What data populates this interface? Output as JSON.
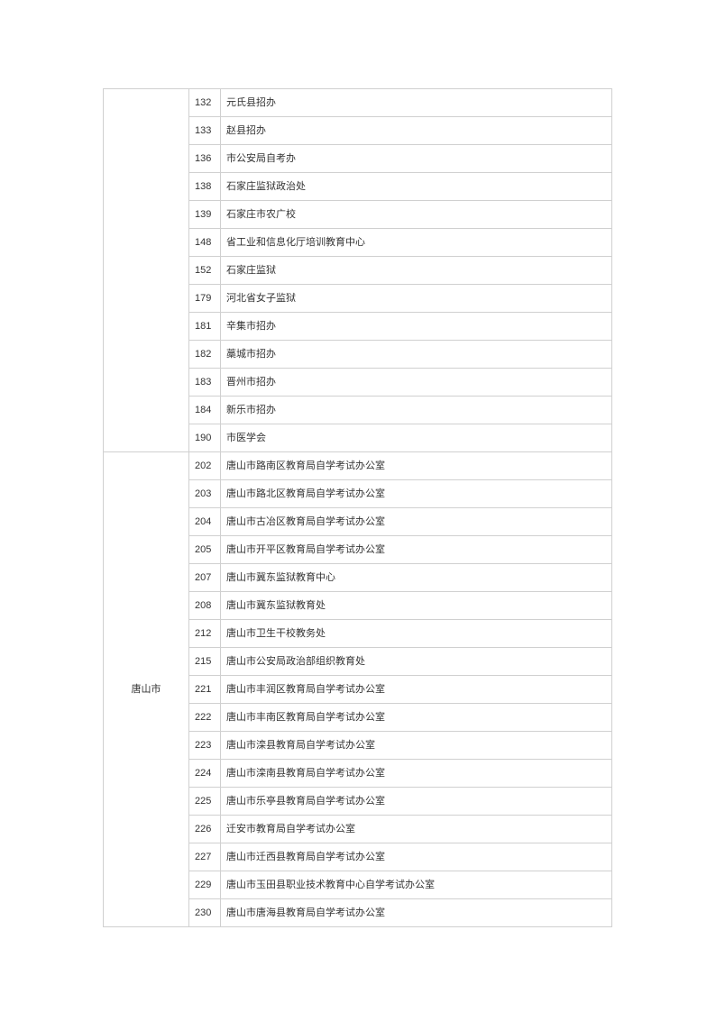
{
  "groups": [
    {
      "region": "",
      "rows": [
        {
          "code": "132",
          "name": "元氏县招办"
        },
        {
          "code": "133",
          "name": "赵县招办"
        },
        {
          "code": "136",
          "name": "市公安局自考办"
        },
        {
          "code": "138",
          "name": "石家庄监狱政治处"
        },
        {
          "code": "139",
          "name": "石家庄市农广校"
        },
        {
          "code": "148",
          "name": "省工业和信息化厅培训教育中心"
        },
        {
          "code": "152",
          "name": "石家庄监狱"
        },
        {
          "code": "179",
          "name": "河北省女子监狱"
        },
        {
          "code": "181",
          "name": "辛集市招办"
        },
        {
          "code": "182",
          "name": "藁城市招办"
        },
        {
          "code": "183",
          "name": "晋州市招办"
        },
        {
          "code": "184",
          "name": "新乐市招办"
        },
        {
          "code": "190",
          "name": "市医学会"
        }
      ]
    },
    {
      "region": "唐山市",
      "rows": [
        {
          "code": "202",
          "name": "唐山市路南区教育局自学考试办公室"
        },
        {
          "code": "203",
          "name": "唐山市路北区教育局自学考试办公室"
        },
        {
          "code": "204",
          "name": "唐山市古冶区教育局自学考试办公室"
        },
        {
          "code": "205",
          "name": "唐山市开平区教育局自学考试办公室"
        },
        {
          "code": "207",
          "name": "唐山市冀东监狱教育中心"
        },
        {
          "code": "208",
          "name": "唐山市冀东监狱教育处"
        },
        {
          "code": "212",
          "name": "唐山市卫生干校教务处"
        },
        {
          "code": "215",
          "name": "唐山市公安局政治部组织教育处"
        },
        {
          "code": "221",
          "name": "唐山市丰润区教育局自学考试办公室"
        },
        {
          "code": "222",
          "name": "唐山市丰南区教育局自学考试办公室"
        },
        {
          "code": "223",
          "name": "唐山市滦县教育局自学考试办公室"
        },
        {
          "code": "224",
          "name": "唐山市滦南县教育局自学考试办公室"
        },
        {
          "code": "225",
          "name": "唐山市乐亭县教育局自学考试办公室"
        },
        {
          "code": "226",
          "name": "迁安市教育局自学考试办公室"
        },
        {
          "code": "227",
          "name": "唐山市迁西县教育局自学考试办公室"
        },
        {
          "code": "229",
          "name": "唐山市玉田县职业技术教育中心自学考试办公室"
        },
        {
          "code": "230",
          "name": "唐山市唐海县教育局自学考试办公室"
        }
      ]
    }
  ]
}
